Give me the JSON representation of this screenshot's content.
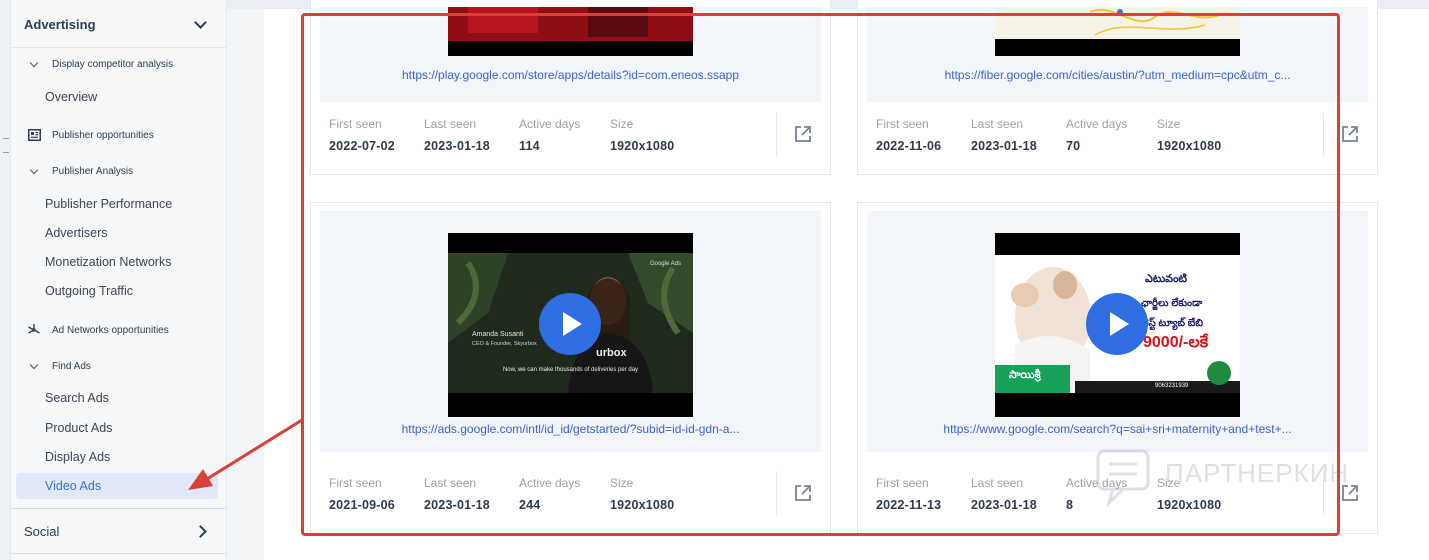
{
  "sidebar": {
    "section_top": "Advertising",
    "display_group": "Display competitor analysis",
    "overview": "Overview",
    "publisher_opps": "Publisher opportunities",
    "publisher_analysis": "Publisher Analysis",
    "publisher_performance": "Publisher Performance",
    "advertisers": "Advertisers",
    "monetization": "Monetization Networks",
    "outgoing": "Outgoing Traffic",
    "adnetworks_opps": "Ad Networks opportunities",
    "find_ads": "Find Ads",
    "search_ads": "Search Ads",
    "product_ads": "Product Ads",
    "display_ads": "Display Ads",
    "video_ads": "Video Ads",
    "section_bottom": "Social"
  },
  "labels": {
    "first_seen": "First seen",
    "last_seen": "Last seen",
    "active_days": "Active days",
    "size": "Size"
  },
  "cards": [
    {
      "url": "https://play.google.com/store/apps/details?id=com.eneos.ssapp",
      "first_seen": "2022-07-02",
      "last_seen": "2023-01-18",
      "active_days": "114",
      "size": "1920x1080"
    },
    {
      "url": "https://fiber.google.com/cities/austin/?utm_medium=cpc&utm_c...",
      "first_seen": "2022-11-06",
      "last_seen": "2023-01-18",
      "active_days": "70",
      "size": "1920x1080"
    },
    {
      "url": "https://ads.google.com/intl/id_id/getstarted/?subid=id-id-gdn-a...",
      "first_seen": "2021-09-06",
      "last_seen": "2023-01-18",
      "active_days": "244",
      "size": "1920x1080"
    },
    {
      "url": "https://www.google.com/search?q=sai+sri+maternity+and+test+...",
      "first_seen": "2022-11-13",
      "last_seen": "2023-01-18",
      "active_days": "8",
      "size": "1920x1080"
    }
  ],
  "thumbs": {
    "video3_tag": "Google Ads",
    "video3_name": "Amanda Susanti",
    "video3_role": "CEO & Founder, Skyurbox",
    "video3_brand": "urbox",
    "video3_caption": "Now, we can make thousands of deliveries per day",
    "video4_line1": "ఎటువంటి",
    "video4_line2": "ఛార్జీలు లేకుండా",
    "video4_line3": "టెస్ట్ ట్యూబ్ బేబి",
    "video4_price": "9000/-లకే",
    "video4_brand": "సాయిశ్రీ",
    "video4_phone": "9063231939"
  },
  "watermark": "ПАРТНЕРКИН",
  "colors": {
    "accent": "#3e63c9",
    "play_button": "#2f6de3",
    "highlight": "#d9403a",
    "active_bg": "#e1e8f7"
  }
}
